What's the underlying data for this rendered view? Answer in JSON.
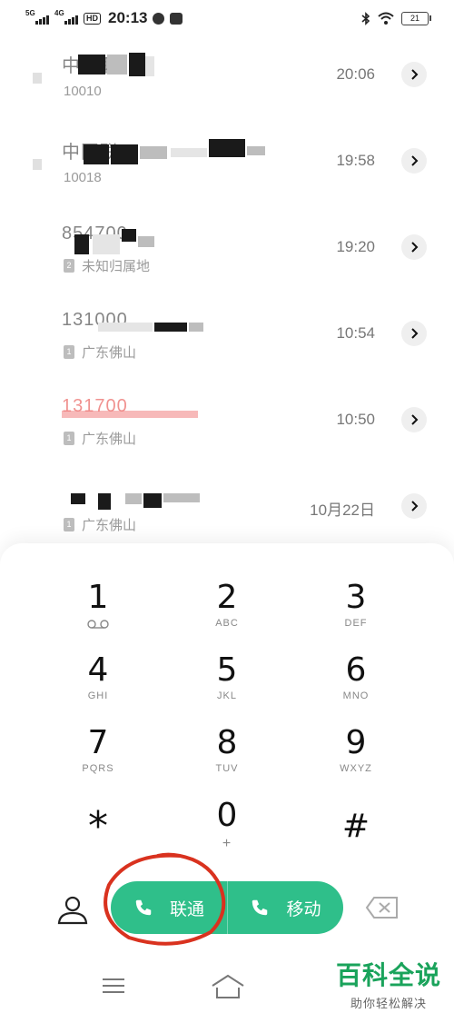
{
  "status_bar": {
    "signal1": "5G",
    "signal2": "4G",
    "hd": "HD",
    "time": "20:13",
    "battery": "21"
  },
  "call_log": [
    {
      "name": "中国联",
      "number": "10010",
      "time": "20:06",
      "name_color": "#222222"
    },
    {
      "name": "中国联",
      "number": "10018",
      "time": "19:58",
      "name_color": "#222222"
    },
    {
      "name": "854700",
      "location": "未知归属地",
      "time": "19:20",
      "name_color": "#222222"
    },
    {
      "name": "131000",
      "location": "广东佛山",
      "time": "10:54",
      "name_color": "#222222"
    },
    {
      "name": "131700",
      "location": "广东佛山",
      "time": "10:50",
      "name_color": "#e53935"
    },
    {
      "name": "",
      "location": "广东佛山",
      "time": "10月22日",
      "name_color": "#222222"
    }
  ],
  "dialpad": {
    "keys": [
      {
        "num": "1",
        "sub": "voicemail"
      },
      {
        "num": "2",
        "sub": "ABC"
      },
      {
        "num": "3",
        "sub": "DEF"
      },
      {
        "num": "4",
        "sub": "GHI"
      },
      {
        "num": "5",
        "sub": "JKL"
      },
      {
        "num": "6",
        "sub": "MNO"
      },
      {
        "num": "7",
        "sub": "PQRS"
      },
      {
        "num": "8",
        "sub": "TUV"
      },
      {
        "num": "9",
        "sub": "WXYZ"
      },
      {
        "num": "*",
        "sub": ""
      },
      {
        "num": "0",
        "sub": "+"
      },
      {
        "num": "#",
        "sub": ""
      }
    ]
  },
  "call_buttons": {
    "sim1_label": "联通",
    "sim2_label": "移动",
    "color": "#2fbf8a"
  },
  "watermark": {
    "title": "百科全说",
    "subtitle": "助你轻松解决"
  },
  "icons": [
    "contacts-icon",
    "phone-icon",
    "backspace-icon",
    "menu-icon",
    "home-icon",
    "chevron-right-icon",
    "bluetooth-icon",
    "wifi-icon"
  ]
}
